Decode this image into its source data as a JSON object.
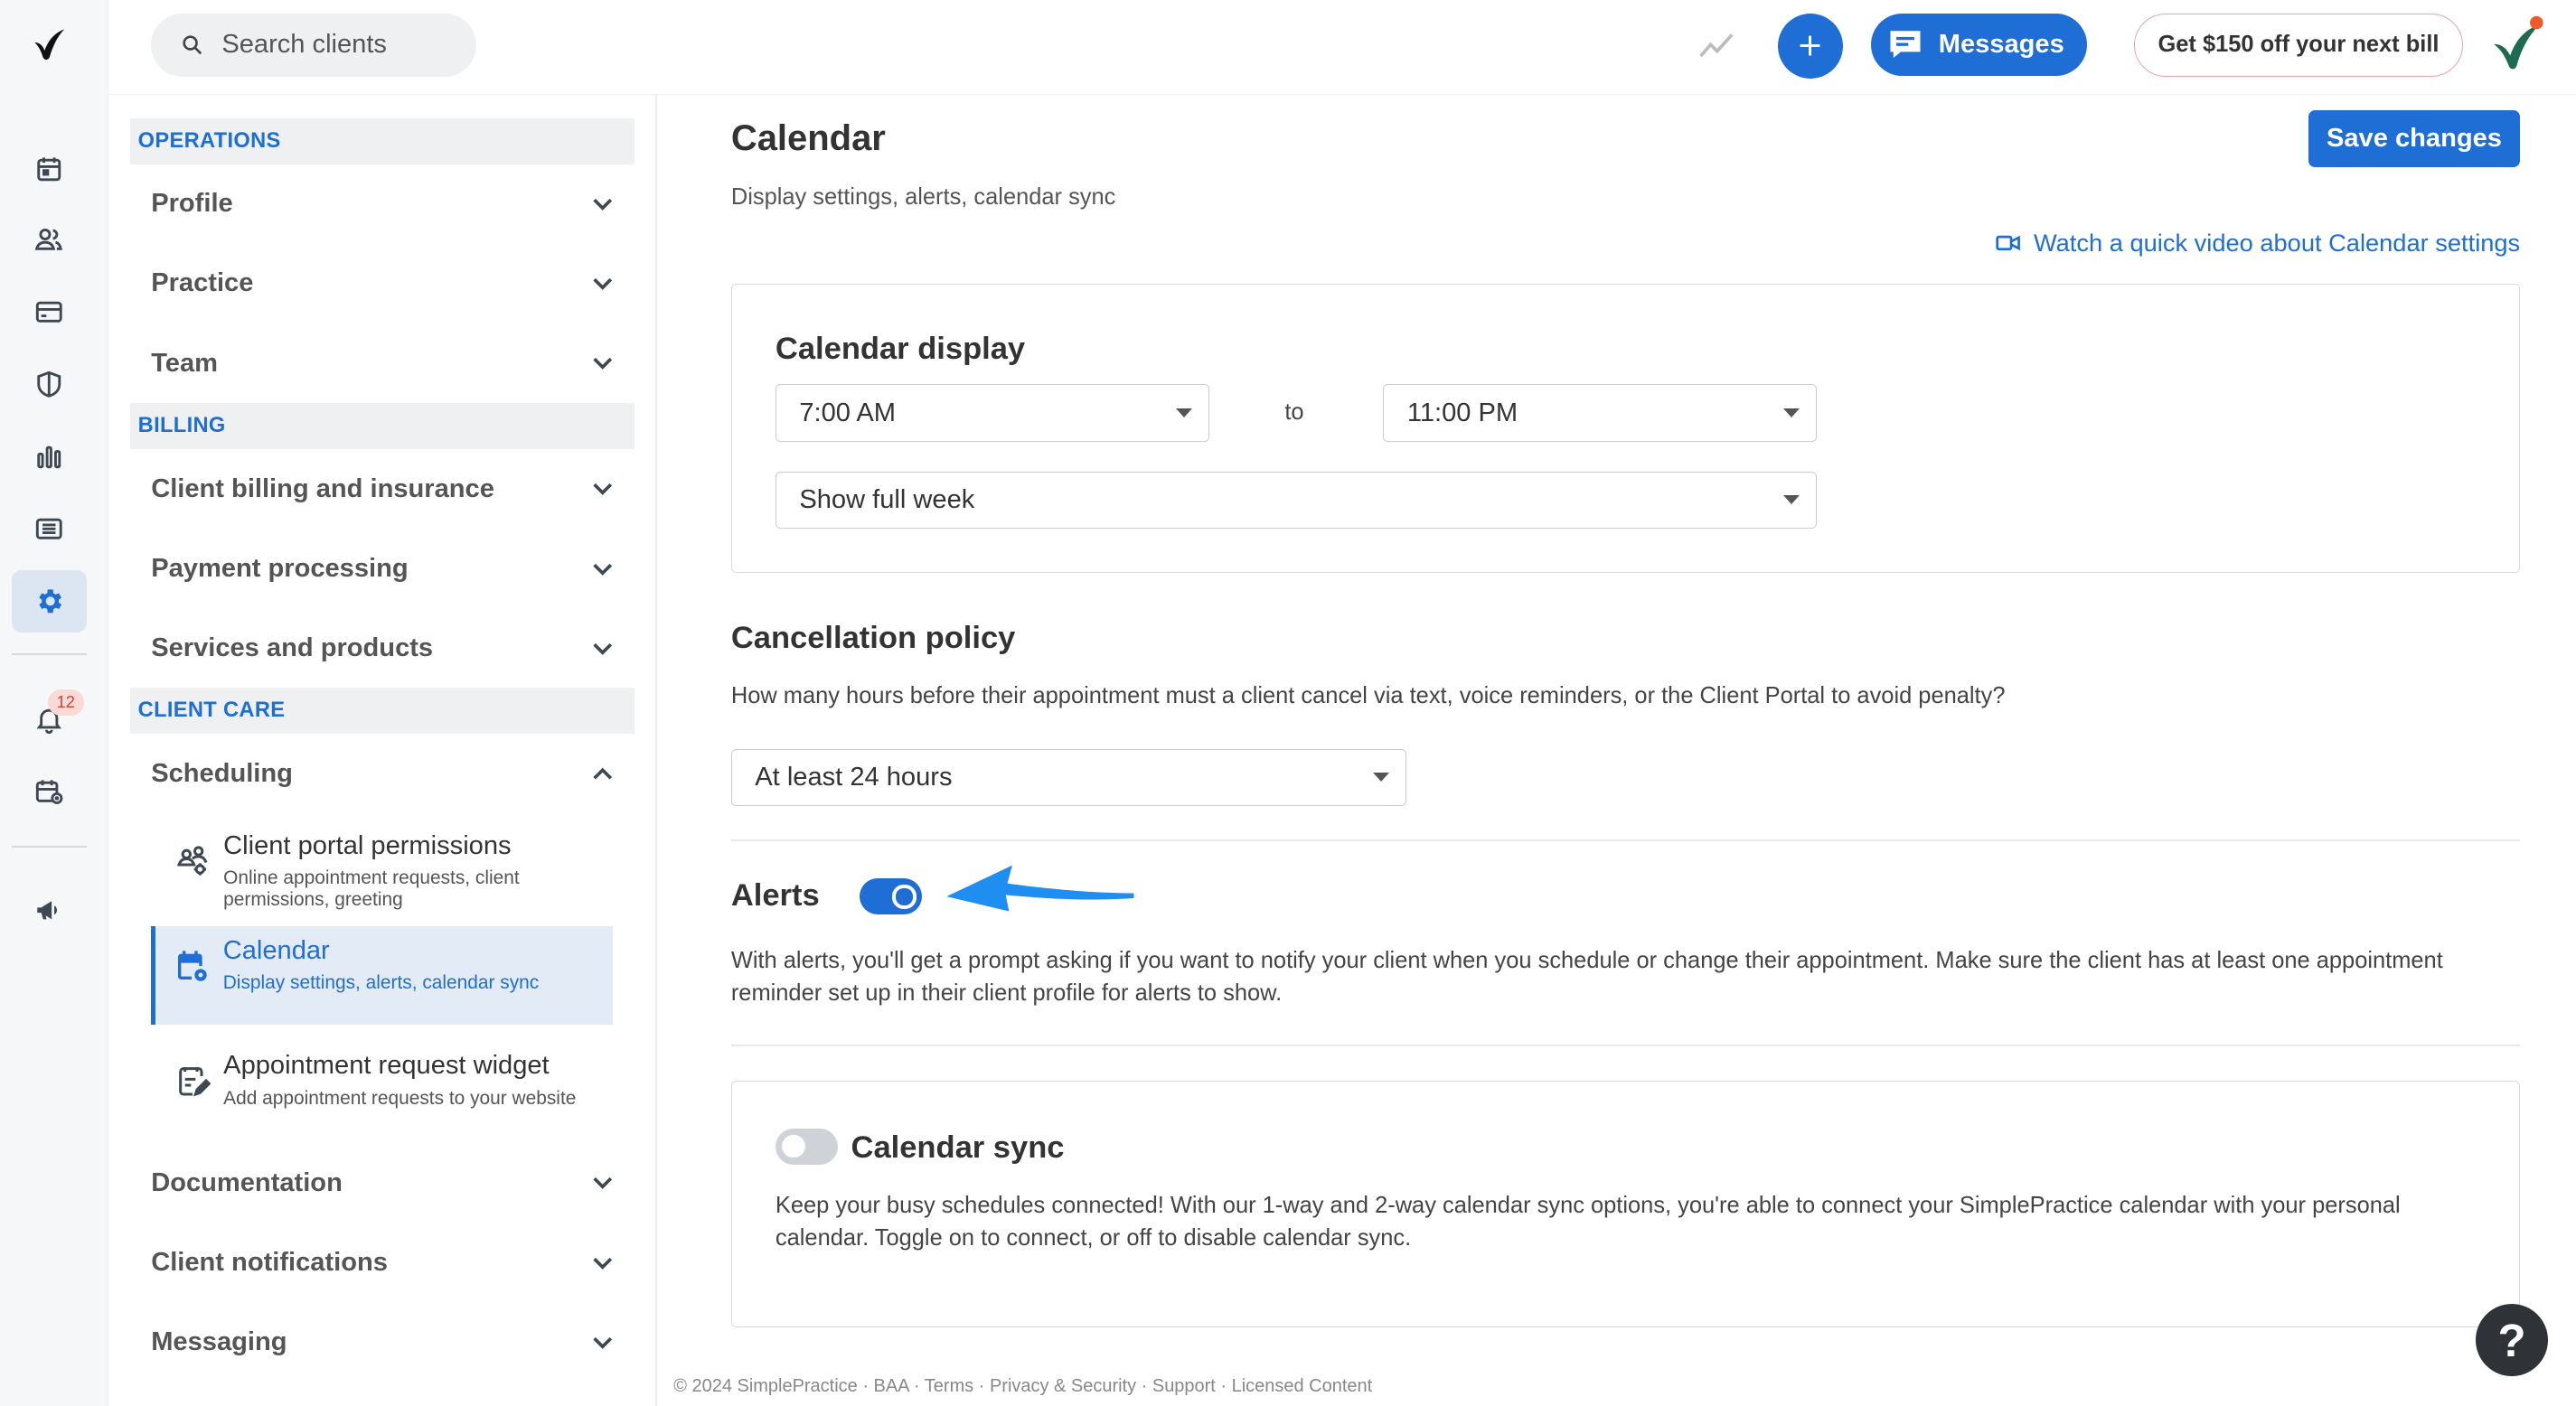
{
  "topbar": {
    "search_placeholder": "Search clients",
    "messages_label": "Messages",
    "promo_label": "Get $150 off your next bill"
  },
  "rail": {
    "notification_count": "12"
  },
  "settings_nav": {
    "sections": [
      {
        "title": "OPERATIONS",
        "items": [
          "Profile",
          "Practice",
          "Team"
        ]
      },
      {
        "title": "BILLING",
        "items": [
          "Client billing and insurance",
          "Payment processing",
          "Services and products"
        ]
      },
      {
        "title": "CLIENT CARE",
        "items": [
          "Scheduling"
        ]
      }
    ],
    "scheduling_sub": [
      {
        "title": "Client portal permissions",
        "desc": "Online appointment requests, client permissions, greeting"
      },
      {
        "title": "Calendar",
        "desc": "Display settings, alerts, calendar sync"
      },
      {
        "title": "Appointment request widget",
        "desc": "Add appointment requests to your website"
      }
    ],
    "after_items": [
      "Documentation",
      "Client notifications",
      "Messaging"
    ]
  },
  "main": {
    "title": "Calendar",
    "subtitle": "Display settings, alerts, calendar sync",
    "save_label": "Save changes",
    "video_link": "Watch a quick video about Calendar settings",
    "display": {
      "heading": "Calendar display",
      "start_time": "7:00 AM",
      "to_label": "to",
      "end_time": "11:00 PM",
      "week_option": "Show full week"
    },
    "cancellation": {
      "heading": "Cancellation policy",
      "question": "How many hours before their appointment must a client cancel via text, voice reminders, or the Client Portal to avoid penalty?",
      "value": "At least 24 hours"
    },
    "alerts": {
      "heading": "Alerts",
      "enabled": true,
      "text": "With alerts, you'll get a prompt asking if you want to notify your client when you schedule or change their appointment. Make sure the client has at least one appointment reminder set up in their client profile for alerts to show."
    },
    "sync": {
      "heading": "Calendar sync",
      "enabled": false,
      "text": "Keep your busy schedules connected! With our 1-way and 2-way calendar sync options, you're able to connect your SimplePractice calendar with your personal calendar. Toggle on to connect, or off to disable calendar sync."
    }
  },
  "footer": "© 2024 SimplePractice · BAA · Terms · Privacy & Security · Support · Licensed Content",
  "help_label": "?",
  "colors": {
    "accent": "#1e6ed6",
    "arrow": "#1f8ef1"
  }
}
